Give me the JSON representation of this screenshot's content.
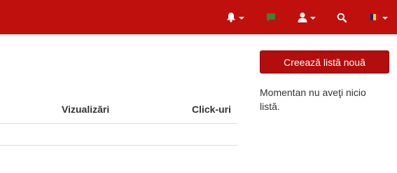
{
  "topbar": {
    "color": "#c0100d",
    "icons": {
      "notifications": "bell-icon",
      "messages": "chat-icon",
      "account": "user-icon",
      "search": "search-icon",
      "language": "romania-flag-icon"
    },
    "flag_colors": [
      "#002b7f",
      "#fcd116",
      "#ce1126"
    ]
  },
  "table": {
    "columns": [
      "Vizualizări",
      "Click-uri"
    ]
  },
  "sidebar": {
    "create_button_label": "Creează listă nouă",
    "empty_message": "Momentan nu aveţi nicio listă."
  }
}
